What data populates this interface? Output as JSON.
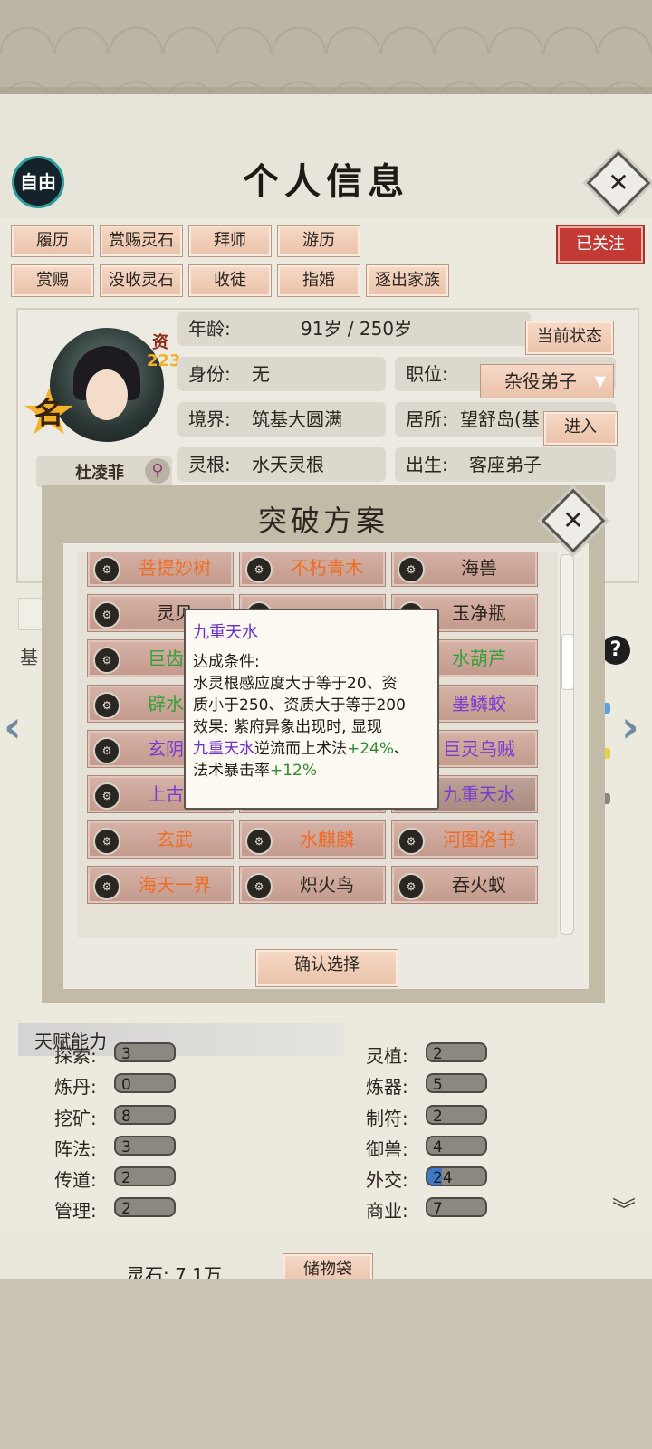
{
  "header": {
    "title": "个人信息",
    "mode_badge": "自由",
    "close": "✕"
  },
  "tabs_row1": [
    "履历",
    "赏赐灵石",
    "拜师",
    "游历"
  ],
  "tabs_row2": [
    "赏赐",
    "没收灵石",
    "收徒",
    "指婚",
    "逐出家族"
  ],
  "follow_badge": "已关注",
  "character": {
    "name": "杜凌菲",
    "name_rank_char": "名",
    "aptitude_label": "资",
    "aptitude_value": "223",
    "gender_symbol": "♀"
  },
  "info": {
    "age_label": "年龄:",
    "age_value": "91岁 / 250岁",
    "status_button": "当前状态",
    "identity_label": "身份:",
    "identity_value": "无",
    "position_label": "职位:",
    "position_value": "杂役弟子",
    "realm_label": "境界:",
    "realm_value": "筑基大圆满",
    "residence_label": "居所:",
    "residence_value": "望舒岛(基",
    "enter_button": "进入",
    "root_label": "灵根:",
    "root_value": "水天灵根",
    "birth_label": "出生:",
    "birth_value": "客座弟子"
  },
  "partial_section_label": "基",
  "breakthrough": {
    "title": "突破方案",
    "confirm_button": "确认选择",
    "items": [
      {
        "label": "菩提妙树",
        "color": "#f06c24"
      },
      {
        "label": "不朽青木",
        "color": "#f06c24"
      },
      {
        "label": "海兽",
        "color": "#2b2620"
      },
      {
        "label": "灵贝",
        "color": "#2b2620"
      },
      {
        "label": "",
        "color": "#2b2620"
      },
      {
        "label": "玉净瓶",
        "color": "#2b2620"
      },
      {
        "label": "巨齿虎",
        "color": "#34a03b"
      },
      {
        "label": "",
        "color": "#2b2620"
      },
      {
        "label": "水葫芦",
        "color": "#34a03b"
      },
      {
        "label": "辟水玥",
        "color": "#34a03b"
      },
      {
        "label": "",
        "color": "#2b2620"
      },
      {
        "label": "墨鳞蛟",
        "color": "#7d3bd0"
      },
      {
        "label": "玄阴真",
        "color": "#7d3bd0"
      },
      {
        "label": "",
        "color": "#2b2620"
      },
      {
        "label": "巨灵乌贼",
        "color": "#7d3bd0"
      },
      {
        "label": "上古鲸",
        "color": "#7d3bd0"
      },
      {
        "label": "",
        "color": "#2b2620"
      },
      {
        "label": "九重天水",
        "color": "#7d3bd0"
      },
      {
        "label": "玄武",
        "color": "#f06c24"
      },
      {
        "label": "水麒麟",
        "color": "#f06c24"
      },
      {
        "label": "河图洛书",
        "color": "#f06c24"
      },
      {
        "label": "海天一界",
        "color": "#f06c24"
      },
      {
        "label": "炽火鸟",
        "color": "#2b2620"
      },
      {
        "label": "吞火蚁",
        "color": "#2b2620"
      }
    ]
  },
  "tooltip": {
    "title": "九重天水",
    "cond_label": "达成条件:",
    "cond_line1": "水灵根感应度大于等于20、资",
    "cond_line2": "质小于250、资质大于等于200",
    "effect_line1": "效果: 紫府异象出现时, 显现",
    "effect_name": "九重天水",
    "effect_mid": "逆流而上术法",
    "effect_bonus1": "+24%",
    "effect_sep": "、",
    "effect_crit": "法术暴击率",
    "effect_bonus2": "+12%"
  },
  "talents": {
    "title": "天赋能力",
    "left": [
      {
        "label": "探索:",
        "value": "3"
      },
      {
        "label": "炼丹:",
        "value": "0"
      },
      {
        "label": "挖矿:",
        "value": "8"
      },
      {
        "label": "阵法:",
        "value": "3"
      },
      {
        "label": "传道:",
        "value": "2"
      },
      {
        "label": "管理:",
        "value": "2"
      }
    ],
    "right": [
      {
        "label": "灵植:",
        "value": "2"
      },
      {
        "label": "炼器:",
        "value": "5"
      },
      {
        "label": "制符:",
        "value": "2"
      },
      {
        "label": "御兽:",
        "value": "4"
      },
      {
        "label": "外交:",
        "value": "24"
      },
      {
        "label": "商业:",
        "value": "7"
      }
    ]
  },
  "footer": {
    "spirit_stone": "灵石: 7.1万",
    "bag_button": "储物袋"
  },
  "colors": {
    "accent_follow": "#c23a33",
    "button_bg": "#eac2aa",
    "rare_orange": "#f06c24",
    "rare_purple": "#7d3bd0",
    "rare_green": "#34a03b"
  }
}
